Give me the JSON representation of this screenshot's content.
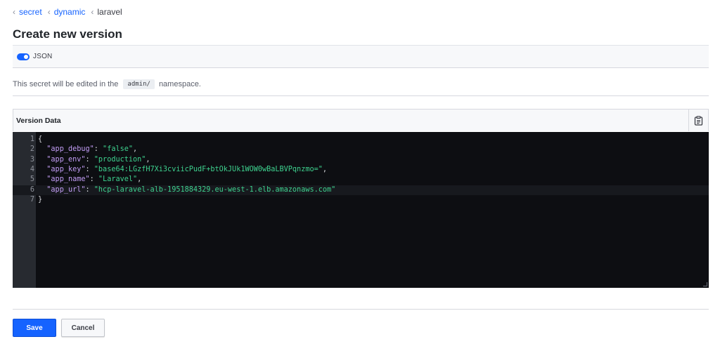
{
  "breadcrumb": [
    {
      "label": "secret",
      "link": true
    },
    {
      "label": "dynamic",
      "link": true
    },
    {
      "label": "laravel",
      "link": false
    }
  ],
  "page_title": "Create new version",
  "json_toggle": {
    "label": "JSON",
    "enabled": true
  },
  "namespace_notice": {
    "prefix": "This secret will be edited in the",
    "namespace": "admin/",
    "suffix": "namespace."
  },
  "version_data": {
    "title": "Version Data",
    "copy_icon": "clipboard-icon",
    "lines": [
      {
        "num": "1",
        "code": "{"
      },
      {
        "num": "2",
        "key": "app_debug",
        "value": "false",
        "comma": true
      },
      {
        "num": "3",
        "key": "app_env",
        "value": "production",
        "comma": true
      },
      {
        "num": "4",
        "key": "app_key",
        "value": "base64:LGzfH7Xi3cviicPudF+btOkJUk1WOW0wBaLBVPqnzmo=",
        "comma": true
      },
      {
        "num": "5",
        "key": "app_name",
        "value": "Laravel",
        "comma": true
      },
      {
        "num": "6",
        "key": "app_url",
        "value": "hcp-laravel-alb-1951884329.eu-west-1.elb.amazonaws.com",
        "comma": false
      },
      {
        "num": "7",
        "code": "}"
      }
    ],
    "active_line": 6
  },
  "actions": {
    "save_label": "Save",
    "cancel_label": "Cancel"
  },
  "colors": {
    "accent": "#1563ff",
    "editor_bg": "#0d0e12",
    "json_key": "#c29df5",
    "json_string": "#3ed28f"
  }
}
